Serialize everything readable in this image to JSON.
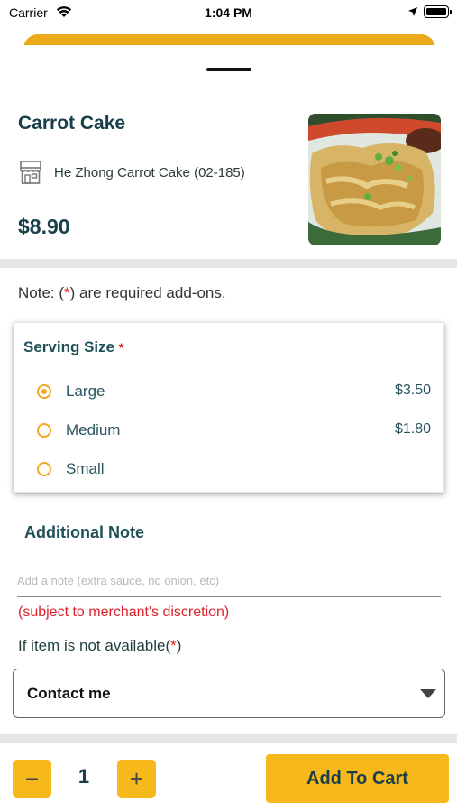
{
  "status_bar": {
    "carrier": "Carrier",
    "time": "1:04 PM"
  },
  "item": {
    "name": "Carrot Cake",
    "merchant": "He Zhong Carrot Cake (02-185)",
    "price": "$8.90",
    "photo_icon": "food-photo"
  },
  "note": {
    "prefix": "Note: (",
    "star": "*",
    "suffix": ") are required add-ons."
  },
  "serving": {
    "title": "Serving Size",
    "required_star": "*",
    "options": [
      {
        "label": "Large",
        "price": "$3.50",
        "selected": true
      },
      {
        "label": "Medium",
        "price": "$1.80",
        "selected": false
      },
      {
        "label": "Small",
        "price": "",
        "selected": false
      }
    ]
  },
  "additional_note": {
    "title": "Additional Note",
    "placeholder": "Add a note (extra sauce, no onion, etc)",
    "value": "",
    "disclaimer": "(subject to merchant's discretion)"
  },
  "unavailable": {
    "label": "If item is not available(",
    "star": "*",
    "suffix": ")",
    "selected": "Contact me"
  },
  "cart": {
    "decrement": "−",
    "quantity": "1",
    "increment": "+",
    "add_label": "Add To Cart"
  },
  "colors": {
    "accent": "#f7b81b",
    "heading": "#17404a",
    "required": "#e02020"
  }
}
